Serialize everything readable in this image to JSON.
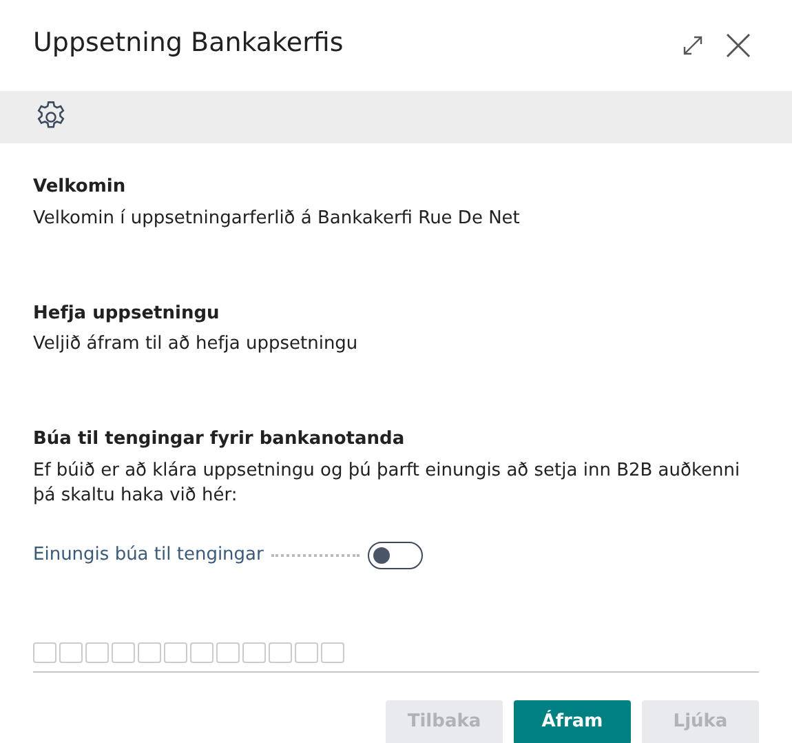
{
  "window": {
    "title": "Uppsetning Bankakerfis"
  },
  "sections": [
    {
      "heading": "Velkomin",
      "text": "Velkomin í uppsetningarferlið á Bankakerfi Rue De Net"
    },
    {
      "heading": "Hefja uppsetningu",
      "text": "Veljið áfram til að hefja uppsetningu"
    },
    {
      "heading": "Búa til tengingar fyrir bankanotanda",
      "text": "Ef búið er að klára uppsetningu og þú þarft einungis að setja inn B2B auðkenni þá skaltu haka við hér:"
    }
  ],
  "toggle": {
    "label": "Einungis búa til tengingar",
    "on": false
  },
  "buttons": [
    {
      "label": "Tilbaka",
      "kind": "secondary",
      "disabled": true
    },
    {
      "label": "Áfram",
      "kind": "primary",
      "disabled": false
    },
    {
      "label": "Ljúka",
      "kind": "secondary",
      "disabled": true
    }
  ]
}
